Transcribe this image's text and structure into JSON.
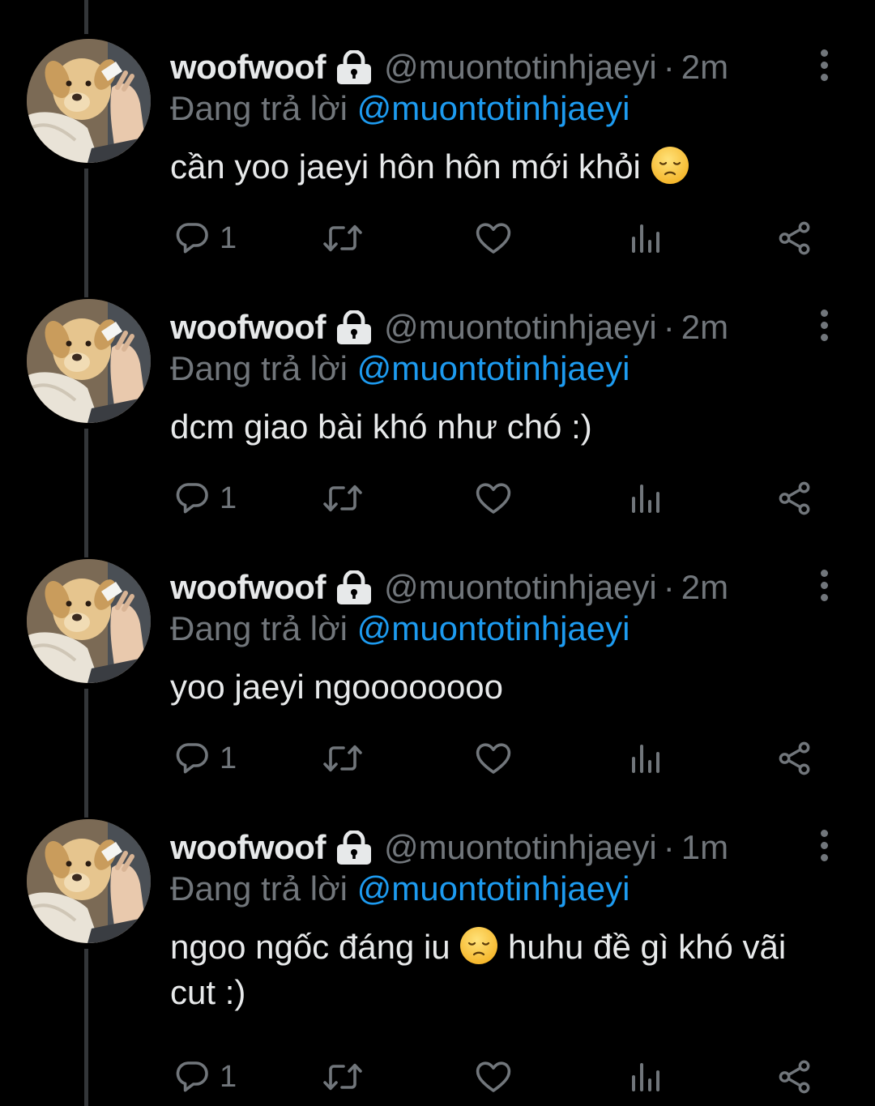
{
  "colors": {
    "background": "#000000",
    "text": "#e7e9ea",
    "muted": "#71767b",
    "link": "#1d9bf0",
    "thread_line": "#333639"
  },
  "tweets": [
    {
      "display_name": "woofwoof",
      "lock_icon": "lock-icon",
      "handle": "@muontotinhjaeyi",
      "separator": "·",
      "time": "2m",
      "reply_prefix": "Đang trả lời",
      "reply_to": "@muontotinhjaeyi",
      "text_before_emoji": "cần yoo jaeyi hôn hôn mới khỏi ",
      "emoji": "disappointed-face-emoji",
      "text_after_emoji": "",
      "reply_count": "1"
    },
    {
      "display_name": "woofwoof",
      "lock_icon": "lock-icon",
      "handle": "@muontotinhjaeyi",
      "separator": "·",
      "time": "2m",
      "reply_prefix": "Đang trả lời",
      "reply_to": "@muontotinhjaeyi",
      "text_before_emoji": "dcm giao bài khó như chó :)",
      "emoji": "",
      "text_after_emoji": "",
      "reply_count": "1"
    },
    {
      "display_name": "woofwoof",
      "lock_icon": "lock-icon",
      "handle": "@muontotinhjaeyi",
      "separator": "·",
      "time": "2m",
      "reply_prefix": "Đang trả lời",
      "reply_to": "@muontotinhjaeyi",
      "text_before_emoji": "yoo jaeyi ngoooooooo",
      "emoji": "",
      "text_after_emoji": "",
      "reply_count": "1"
    },
    {
      "display_name": "woofwoof",
      "lock_icon": "lock-icon",
      "handle": "@muontotinhjaeyi",
      "separator": "·",
      "time": "1m",
      "reply_prefix": "Đang trả lời",
      "reply_to": "@muontotinhjaeyi",
      "text_before_emoji": "ngoo ngốc đáng iu ",
      "emoji": "disappointed-face-emoji",
      "text_after_emoji": " huhu đề gì khó vãi cut :)",
      "reply_count": "1"
    }
  ],
  "action_icons": [
    "reply-icon",
    "retweet-icon",
    "like-icon",
    "views-icon",
    "share-icon"
  ]
}
